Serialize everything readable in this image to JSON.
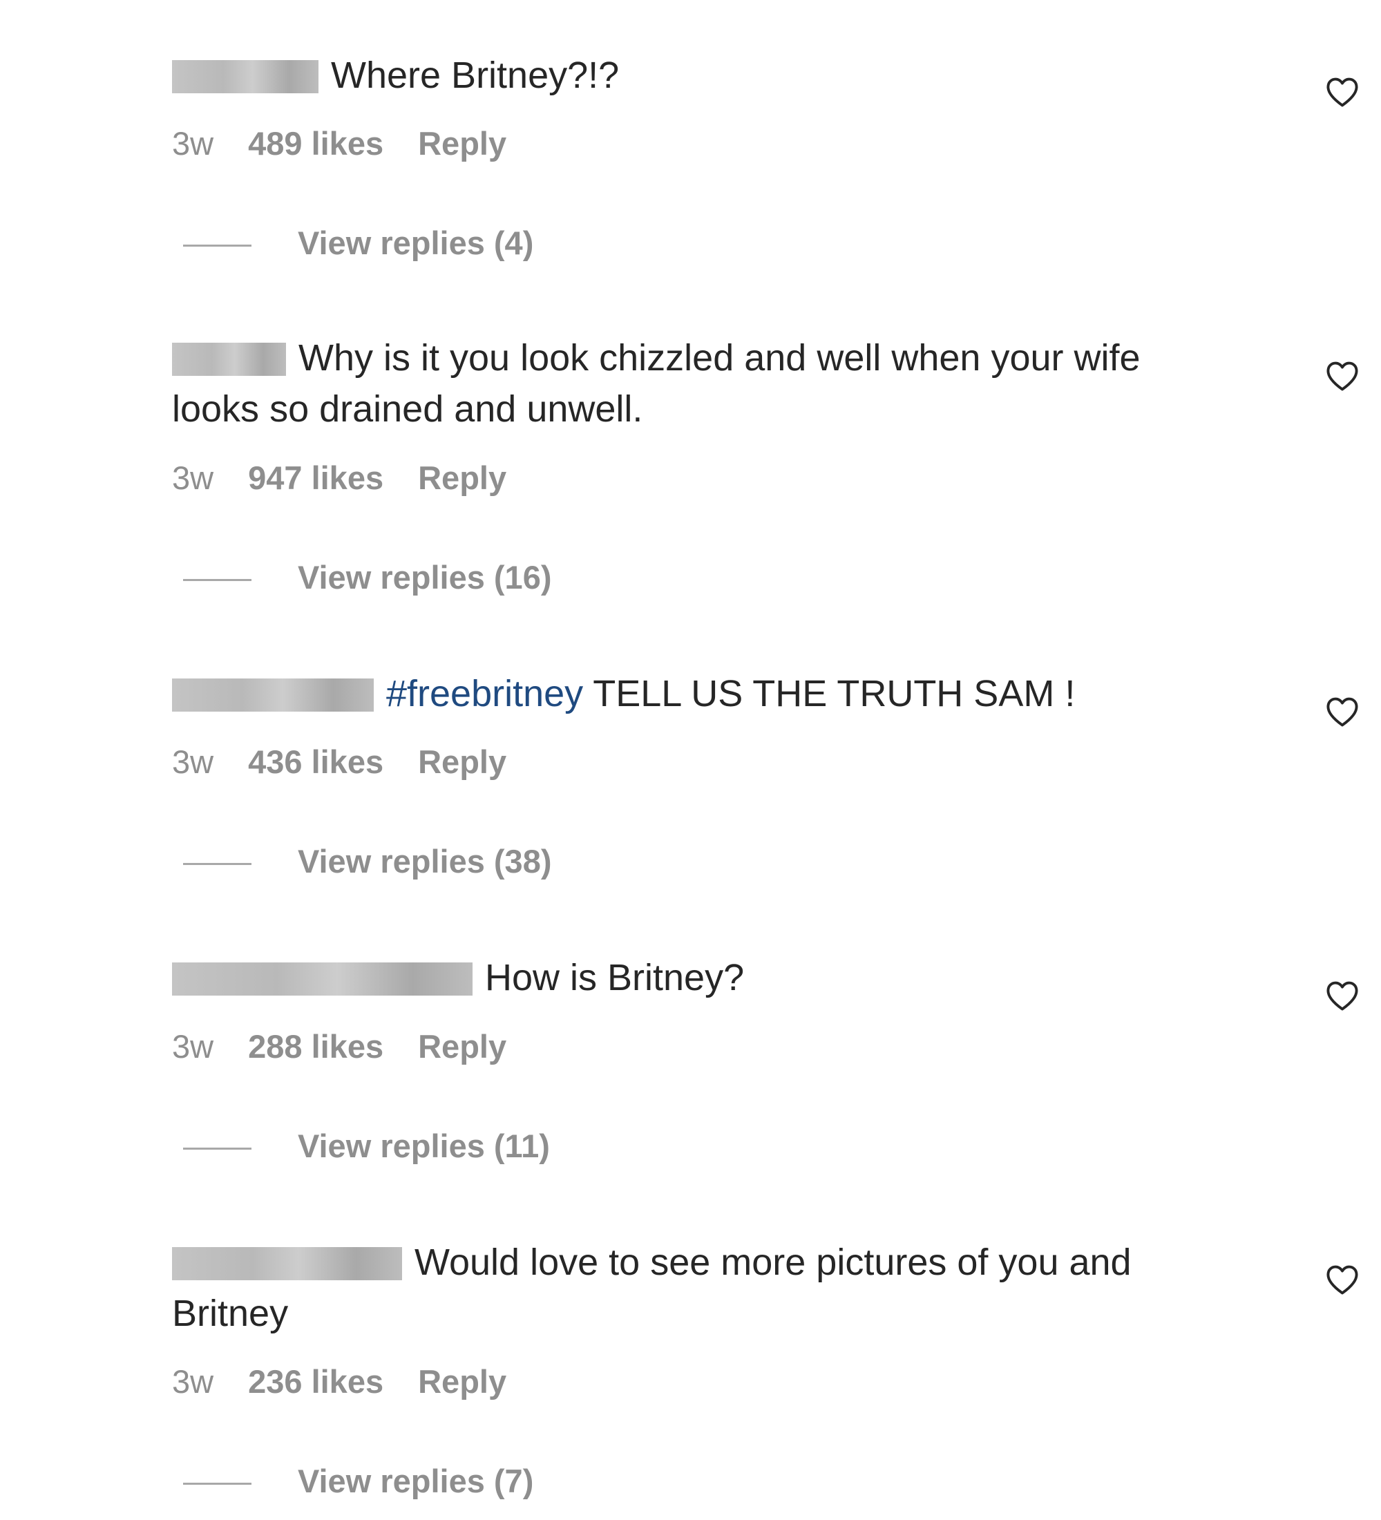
{
  "comments": [
    {
      "text": "Where Britney?!?",
      "time": "3w",
      "likes": "489 likes",
      "reply_label": "Reply",
      "view_replies": "View replies (4)"
    },
    {
      "text": "Why is it you look chizzled and well when your wife looks so drained and unwell.",
      "time": "3w",
      "likes": "947 likes",
      "reply_label": "Reply",
      "view_replies": "View replies (16)"
    },
    {
      "hashtag": "#freebritney",
      "text": "TELL US THE TRUTH SAM !",
      "time": "3w",
      "likes": "436 likes",
      "reply_label": "Reply",
      "view_replies": "View replies (38)"
    },
    {
      "text": "How is Britney?",
      "time": "3w",
      "likes": "288 likes",
      "reply_label": "Reply",
      "view_replies": "View replies (11)"
    },
    {
      "text": "Would love to see more pictures of you and Britney",
      "time": "3w",
      "likes": "236 likes",
      "reply_label": "Reply",
      "view_replies": "View replies (7)"
    }
  ],
  "icons": {
    "like": "heart-outline-icon"
  },
  "colors": {
    "text": "#262626",
    "secondary": "#8e8e8e",
    "hashtag": "#1f4a80"
  }
}
